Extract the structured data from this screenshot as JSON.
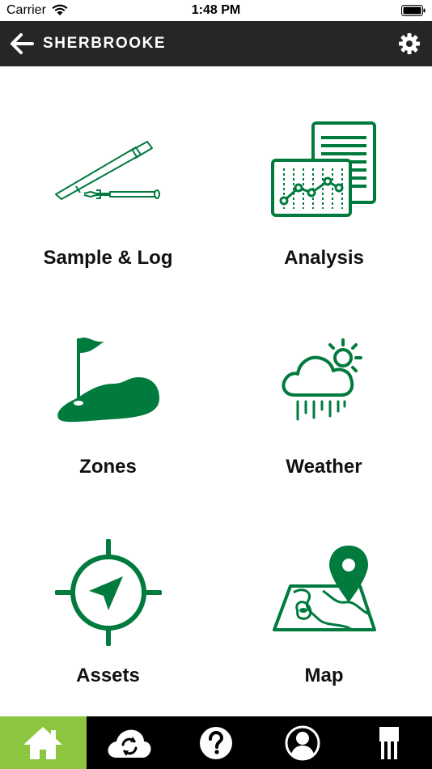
{
  "status_bar": {
    "carrier": "Carrier",
    "time": "1:48 PM"
  },
  "nav": {
    "title": "SHERBROOKE",
    "back_icon": "arrow-left-icon",
    "settings_icon": "gear-icon"
  },
  "tiles": [
    {
      "label": "Sample & Log",
      "icon": "probe-meter-icon"
    },
    {
      "label": "Analysis",
      "icon": "report-chart-icon"
    },
    {
      "label": "Zones",
      "icon": "golf-green-flag-icon"
    },
    {
      "label": "Weather",
      "icon": "cloud-sun-rain-icon"
    },
    {
      "label": "Assets",
      "icon": "compass-crosshair-icon"
    },
    {
      "label": "Map",
      "icon": "map-pin-icon"
    }
  ],
  "tab_bar": {
    "tabs": [
      {
        "icon": "home-icon",
        "active": true
      },
      {
        "icon": "cloud-sync-icon",
        "active": false
      },
      {
        "icon": "help-icon",
        "active": false
      },
      {
        "icon": "user-icon",
        "active": false
      },
      {
        "icon": "sensor-probe-icon",
        "active": false
      }
    ]
  },
  "colors": {
    "accent_green": "#007a3d",
    "tab_active": "#8cc63f",
    "nav_bar": "#262626"
  }
}
